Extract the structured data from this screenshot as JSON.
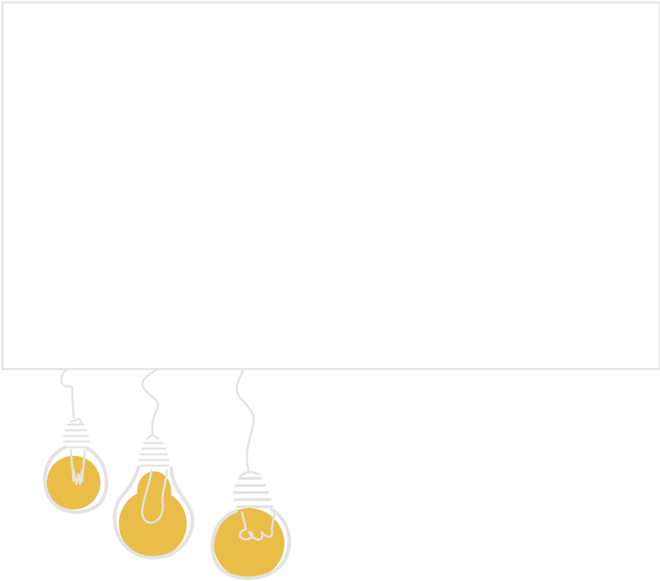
{
  "colors": {
    "frame_border": "#e6e6e6",
    "background": "#ffffff",
    "bulb_fill": "#e9bd47",
    "line": "#e3e3e3"
  },
  "icons": {
    "bulb_left": "light-bulb-icon",
    "bulb_middle": "light-bulb-icon",
    "bulb_right": "light-bulb-icon"
  }
}
